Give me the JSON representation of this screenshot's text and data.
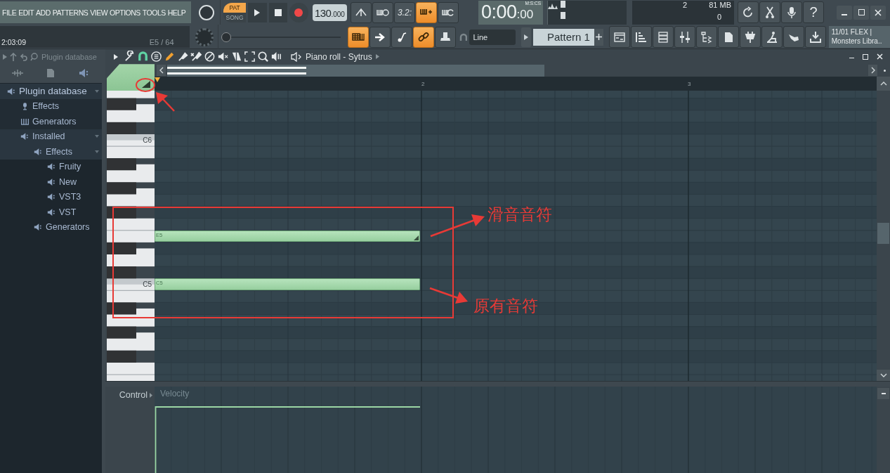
{
  "menu": [
    "FILE",
    "EDIT",
    "ADD",
    "PATTERNS",
    "VIEW",
    "OPTIONS",
    "TOOLS",
    "HELP"
  ],
  "hint_panel": {
    "time": "2:03:09",
    "note": "E5 / 64"
  },
  "transport": {
    "pat": "PAT",
    "song": "SONG",
    "pat_selected": true,
    "tempo": "130",
    "tempo_fraction": ".000"
  },
  "view_buttons": [
    {
      "on": false
    },
    {
      "on": false
    },
    {
      "label": "3.2:",
      "on": false
    },
    {
      "on": true
    },
    {
      "on": false
    }
  ],
  "time_display": {
    "main": "0:00",
    "fraction": ":00",
    "format": "M:S:CS"
  },
  "cpu": {
    "voices": "2",
    "memory": "81 MB",
    "polyphony": "0"
  },
  "tool_buttons": [
    {
      "on": false
    },
    {
      "on": false
    },
    {
      "on": false
    },
    {
      "label": "?",
      "on": false
    }
  ],
  "pitch_slider": {
    "level": 0
  },
  "mode_buttons": [
    {
      "on": true
    },
    {
      "on": false
    },
    {
      "on": false
    },
    {
      "on": true
    },
    {
      "on": false
    }
  ],
  "snap": "Line",
  "pattern": "Pattern 1",
  "window_buttons": [
    {
      "on": false
    },
    {
      "on": false
    },
    {
      "on": false
    },
    {
      "on": false
    },
    {
      "on": false
    },
    {
      "on": false
    },
    {
      "on": false
    },
    {
      "on": false
    },
    {
      "on": false
    },
    {
      "on": false
    }
  ],
  "hint_box": {
    "line_1": "11/01  FLEX |",
    "line_2": "Monsters Libra.."
  },
  "browser": {
    "title": "Plugin database",
    "tree": [
      {
        "label": "Plugin database",
        "kind": "plugin",
        "expanded": true,
        "children": [
          {
            "label": "Effects",
            "kind": "effect"
          },
          {
            "label": "Generators",
            "kind": "generator"
          },
          {
            "label": "Installed",
            "kind": "plugin",
            "expanded": true,
            "children": [
              {
                "label": "Effects",
                "kind": "plugin",
                "expanded": true,
                "children": [
                  {
                    "label": "Fruity",
                    "kind": "plugin"
                  },
                  {
                    "label": "New",
                    "kind": "plugin"
                  },
                  {
                    "label": "VST3",
                    "kind": "plugin"
                  },
                  {
                    "label": "VST",
                    "kind": "plugin"
                  }
                ]
              },
              {
                "label": "Generators",
                "kind": "plugin"
              }
            ]
          }
        ]
      }
    ]
  },
  "piano_roll": {
    "title": "Piano roll - Sytrus",
    "ruler": [
      "2",
      "3"
    ],
    "key_labels": [
      "C6",
      "C5"
    ],
    "notes": [
      {
        "label": "E5",
        "slide": true
      },
      {
        "label": "C5",
        "slide": false
      }
    ],
    "control": {
      "label": "Control",
      "parameter": "Velocity"
    }
  },
  "annotations": [
    "滑音音符",
    "原有音符"
  ]
}
